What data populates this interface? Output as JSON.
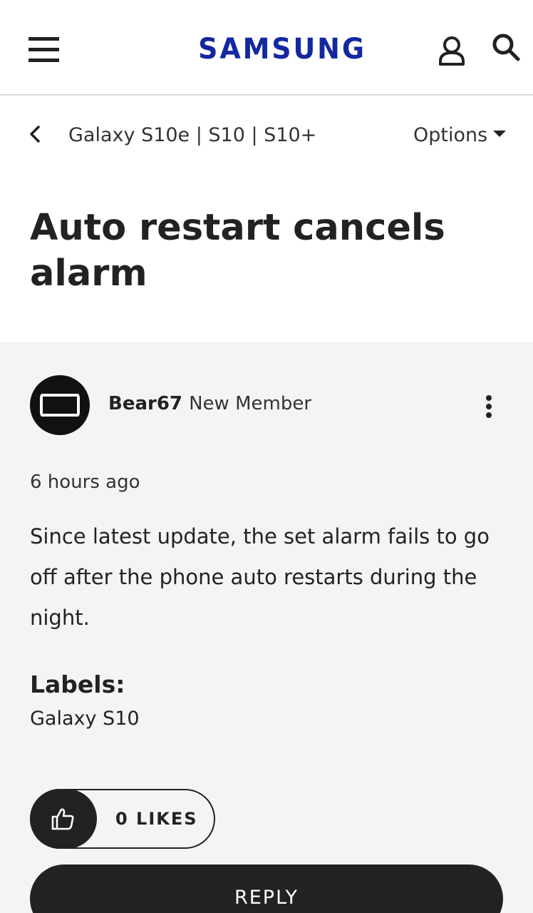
{
  "header": {
    "brand": "SAMSUNG",
    "brand_color": "#1428a0",
    "icons": [
      "hamburger-menu-icon",
      "user-icon",
      "search-icon"
    ]
  },
  "breadcrumb": {
    "back_icon": "chevron-left-icon",
    "text": "Galaxy S10e | S10 | S10+",
    "options_label": "Options"
  },
  "thread": {
    "title": "Auto restart cancels alarm"
  },
  "post": {
    "author": "Bear67",
    "role": "New Member",
    "timestamp": "6 hours ago",
    "body": "Since latest update, the set alarm fails to go off after the phone auto restarts during the night.",
    "labels_heading": "Labels:",
    "label": "Galaxy S10",
    "likes_label": "0 LIKES",
    "reply_label": "REPLY"
  },
  "colors": {
    "post_background": "#f4f4f4",
    "button_dark": "#222222"
  }
}
